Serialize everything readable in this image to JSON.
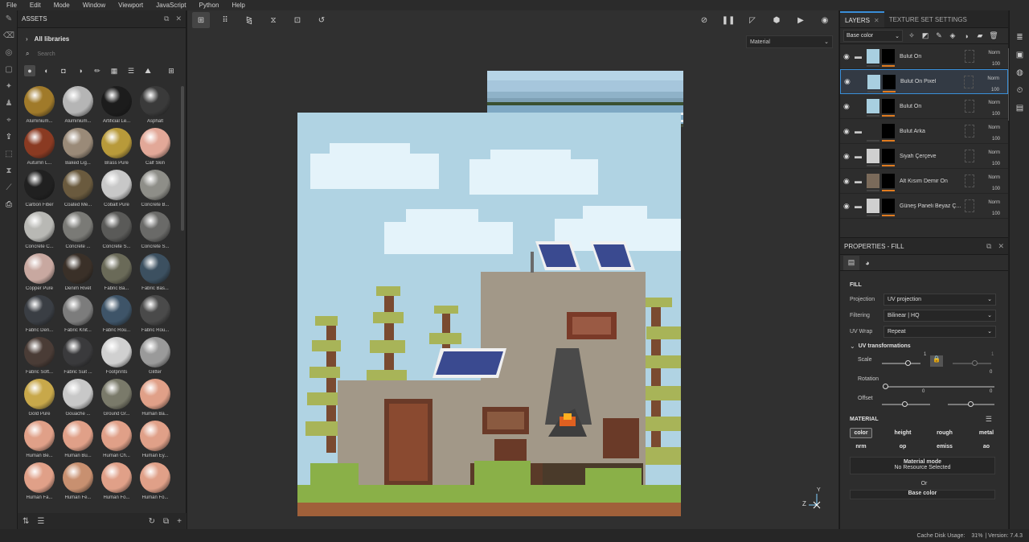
{
  "menu": [
    "File",
    "Edit",
    "Mode",
    "Window",
    "Viewport",
    "JavaScript",
    "Python",
    "Help"
  ],
  "assets": {
    "title": "ASSETS",
    "library": "All libraries",
    "search_placeholder": "Search",
    "materials": [
      {
        "name": "Aluminium...",
        "color": "#a07a2a"
      },
      {
        "name": "Aluminium...",
        "color": "#b5b5b5"
      },
      {
        "name": "Artificial Le...",
        "color": "#1c1c1c"
      },
      {
        "name": "Asphalt",
        "color": "#3a3a3a"
      },
      {
        "name": "Autumn L...",
        "color": "#8a3a22"
      },
      {
        "name": "Baked Lig...",
        "color": "#9a8a78"
      },
      {
        "name": "Brass Pure",
        "color": "#b89a3a"
      },
      {
        "name": "Calf Skin",
        "color": "#e2a898"
      },
      {
        "name": "Carbon Fiber",
        "color": "#202020"
      },
      {
        "name": "Coated Me...",
        "color": "#6a5a3e"
      },
      {
        "name": "Cobalt Pure",
        "color": "#c8c8c8"
      },
      {
        "name": "Concrete B...",
        "color": "#8e8e88"
      },
      {
        "name": "Concrete C...",
        "color": "#b8b8b4"
      },
      {
        "name": "Concrete ...",
        "color": "#7a7a76"
      },
      {
        "name": "Concrete S...",
        "color": "#5a5a58"
      },
      {
        "name": "Concrete S...",
        "color": "#6a6a68"
      },
      {
        "name": "Copper Pure",
        "color": "#c8a8a0"
      },
      {
        "name": "Denim Rivet",
        "color": "#3a3028"
      },
      {
        "name": "Fabric Ba...",
        "color": "#6a6a58"
      },
      {
        "name": "Fabric Bas...",
        "color": "#3c5060"
      },
      {
        "name": "Fabric Den...",
        "color": "#3a3e44"
      },
      {
        "name": "Fabric Knit...",
        "color": "#7c7c7c"
      },
      {
        "name": "Fabric Rou...",
        "color": "#3e5468"
      },
      {
        "name": "Fabric Rou...",
        "color": "#4a4a4a"
      },
      {
        "name": "Fabric Soft...",
        "color": "#4a3c36"
      },
      {
        "name": "Fabric Suit ...",
        "color": "#3a3a3c"
      },
      {
        "name": "Footprints",
        "color": "#d0d0d0"
      },
      {
        "name": "Glitter",
        "color": "#9a9a9a"
      },
      {
        "name": "Gold Pure",
        "color": "#c8a84a"
      },
      {
        "name": "Gouache ...",
        "color": "#c8c8c8"
      },
      {
        "name": "Ground Gr...",
        "color": "#7a7a6a"
      },
      {
        "name": "Human Ba...",
        "color": "#e0a088"
      },
      {
        "name": "Human Be...",
        "color": "#e0a088"
      },
      {
        "name": "Human Bu...",
        "color": "#e0a088"
      },
      {
        "name": "Human Ch...",
        "color": "#e0a088"
      },
      {
        "name": "Human Ey...",
        "color": "#e0a088"
      },
      {
        "name": "Human Fa...",
        "color": "#e0a088"
      },
      {
        "name": "Human Fe...",
        "color": "#c89070"
      },
      {
        "name": "Human Fo...",
        "color": "#e0a088"
      },
      {
        "name": "Human Fo...",
        "color": "#e0a088"
      }
    ]
  },
  "viewport": {
    "material_select": "Material",
    "axis_z": "Z",
    "axis_y": "Y"
  },
  "layers": {
    "tab_layers": "LAYERS",
    "tab_tss": "TEXTURE SET SETTINGS",
    "channel": "Base color",
    "items": [
      {
        "name": "Bulut Ön",
        "blend": "Norm",
        "opacity": "100",
        "thumb": "#a8cfe0",
        "folder": true
      },
      {
        "name": "Bulut Ön Pixel",
        "blend": "Norm",
        "opacity": "100",
        "thumb": "#a8cfe0",
        "folder": false
      },
      {
        "name": "Bulut Ön",
        "blend": "Norm",
        "opacity": "100",
        "thumb": "#a8cfe0",
        "folder": false
      },
      {
        "name": "Bulut Arka",
        "blend": "Norm",
        "opacity": "100",
        "thumb": "#2d2d2d",
        "folder": true
      },
      {
        "name": "Siyah Çerçeve",
        "blend": "Norm",
        "opacity": "100",
        "thumb": "#cfcfcf",
        "folder": true
      },
      {
        "name": "Alt Kısım Demir Ön",
        "blend": "Norm",
        "opacity": "100",
        "thumb": "#7a6a5a",
        "folder": true
      },
      {
        "name": "Güneş Paneli Beyaz Ç...",
        "blend": "Norm",
        "opacity": "100",
        "thumb": "#cfcfcf",
        "folder": true
      }
    ]
  },
  "properties": {
    "title": "PROPERTIES - FILL",
    "fill": "FILL",
    "projection_label": "Projection",
    "projection": "UV projection",
    "filtering_label": "Filtering",
    "filtering": "Bilinear | HQ",
    "uvwrap_label": "UV Wrap",
    "uvwrap": "Repeat",
    "uvt": "UV transformations",
    "scale_label": "Scale",
    "scale_val": "1",
    "scale_val2": "1",
    "scale_val3": "0",
    "rotation_label": "Rotation",
    "offset_label": "Offset",
    "offset_val1": "0",
    "offset_val2": "0",
    "material": "MATERIAL",
    "channels": [
      "color",
      "height",
      "rough",
      "metal",
      "nrm",
      "op",
      "emiss",
      "ao"
    ],
    "material_mode": "Material mode",
    "no_resource": "No Resource Selected",
    "or": "Or",
    "base_color": "Base color"
  },
  "status": {
    "cache": "Cache Disk Usage:",
    "usage": "31%",
    "version": "| Version: 7.4.3"
  }
}
